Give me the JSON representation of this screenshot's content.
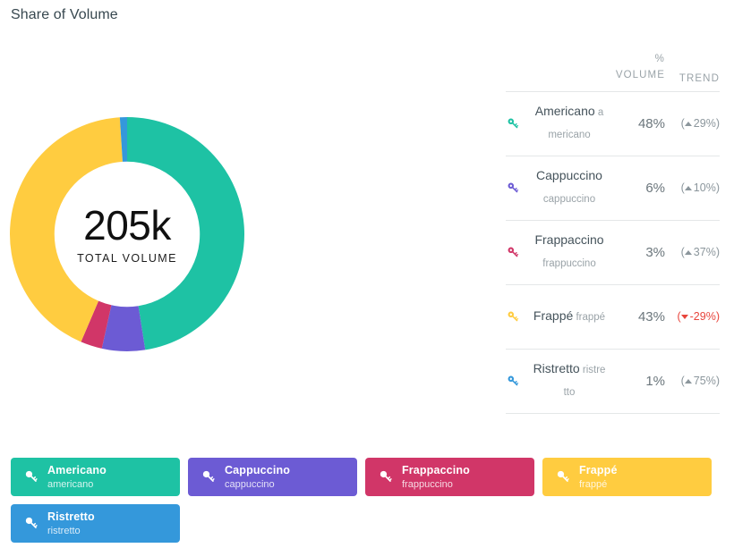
{
  "header": {
    "title": "Share of Volume"
  },
  "donut": {
    "total": "205k",
    "total_label": "TOTAL VOLUME"
  },
  "table": {
    "columns": {
      "percent_symbol": "%",
      "volume": "VOLUME",
      "trend": "TREND"
    },
    "rows": [
      {
        "icon": "key-icon",
        "name": "Americano",
        "subtitle": "americano",
        "volume": "48%",
        "trend": "29%",
        "trend_full": "(▲ 29%)",
        "trend_direction": "up",
        "color": "#1ec2a4"
      },
      {
        "icon": "key-icon",
        "name": "Cappuccino",
        "subtitle": "cappuccino",
        "volume": "6%",
        "trend": "10%",
        "trend_full": "(▲ 10%)",
        "trend_direction": "up",
        "color": "#6c5bd4"
      },
      {
        "icon": "key-icon",
        "name": "Frappaccino",
        "subtitle": "frappuccino",
        "volume": "3%",
        "trend": "37%",
        "trend_full": "(▲ 37%)",
        "trend_direction": "up",
        "color": "#d13668"
      },
      {
        "icon": "key-icon",
        "name": "Frappé",
        "subtitle": "frappé",
        "volume": "43%",
        "trend": "-29%",
        "trend_full": "(▼ -29%)",
        "trend_direction": "down",
        "color": "#ffcc40"
      },
      {
        "icon": "key-icon",
        "name": "Ristretto",
        "subtitle": "ristretto",
        "volume": "1%",
        "trend": "75%",
        "trend_full": "(▲ 75%)",
        "trend_direction": "up",
        "color": "#3498db"
      }
    ]
  },
  "legend": {
    "items": [
      {
        "icon": "key-icon",
        "name": "Americano",
        "subtitle": "americano",
        "color": "#1ec2a4"
      },
      {
        "icon": "key-icon",
        "name": "Cappuccino",
        "subtitle": "cappuccino",
        "color": "#6c5bd4"
      },
      {
        "icon": "key-icon",
        "name": "Frappaccino",
        "subtitle": "frappuccino",
        "color": "#d13668"
      },
      {
        "icon": "key-icon",
        "name": "Frappé",
        "subtitle": "frappé",
        "color": "#ffcc40"
      },
      {
        "icon": "key-icon",
        "name": "Ristretto",
        "subtitle": "ristretto",
        "color": "#3498db"
      }
    ]
  },
  "chart_data": {
    "type": "pie",
    "variant": "donut",
    "title": "Share of Volume",
    "center_value": "205k",
    "center_label": "TOTAL VOLUME",
    "categories": [
      "Americano",
      "Cappuccino",
      "Frappaccino",
      "Frappé",
      "Ristretto"
    ],
    "values": [
      48,
      6,
      3,
      43,
      1
    ],
    "unit": "%",
    "colors": [
      "#1ec2a4",
      "#6c5bd4",
      "#d13668",
      "#ffcc40",
      "#3498db"
    ],
    "trend": [
      29,
      10,
      37,
      -29,
      75
    ],
    "legend_position": "bottom",
    "grid": false,
    "start_angle_deg": 0,
    "direction": "clockwise",
    "inner_radius_ratio": 0.62
  }
}
